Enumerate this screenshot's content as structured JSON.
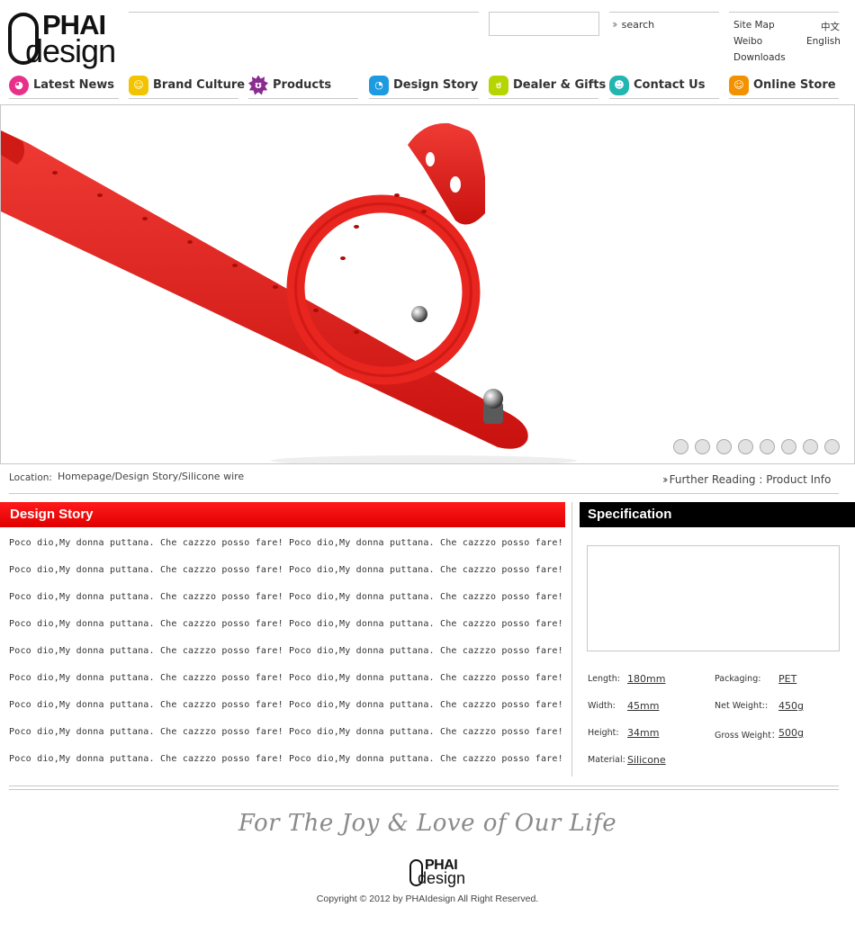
{
  "logo": {
    "top_text": "PHAI",
    "bottom_text": "design"
  },
  "search": {
    "placeholder": "",
    "button_label": "search"
  },
  "utility": {
    "site_map": "Site Map",
    "chinese": "中文",
    "weibo": "Weibo",
    "english": "English",
    "downloads": "Downloads"
  },
  "nav": {
    "items": [
      {
        "label": "Latest News",
        "icon": "smiley-pink-icon",
        "color": "#e8308a"
      },
      {
        "label": "Brand Culture",
        "icon": "smiley-yellow-icon",
        "color": "#f2c400"
      },
      {
        "label": "Products",
        "icon": "smiley-purple-icon",
        "color": "#8a2c8f"
      },
      {
        "label": "Design Story",
        "icon": "smiley-blue-icon",
        "color": "#1e9be0"
      },
      {
        "label": "Dealer & Gifts",
        "icon": "smiley-lime-icon",
        "color": "#b6d400"
      },
      {
        "label": "Contact Us",
        "icon": "smiley-teal-icon",
        "color": "#23b5b0"
      },
      {
        "label": "Online Store",
        "icon": "smiley-orange-icon",
        "color": "#f39200"
      }
    ]
  },
  "hero": {
    "slide_count": 8,
    "image": "red-silicone-bracelet-photo"
  },
  "location": {
    "label": "Location:",
    "path": "Homepage/Design Story/Silicone wire",
    "further_reading": "Further Reading : Product Info"
  },
  "design_story": {
    "title": "Design Story",
    "lines": [
      "Poco dio,My donna puttana. Che cazzzo posso fare! Poco dio,My donna puttana. Che cazzzo posso fare!",
      "Poco dio,My donna puttana. Che cazzzo posso fare! Poco dio,My donna puttana. Che cazzzo posso fare!",
      "Poco dio,My donna puttana. Che cazzzo posso fare! Poco dio,My donna puttana. Che cazzzo posso fare!",
      "Poco dio,My donna puttana. Che cazzzo posso fare! Poco dio,My donna puttana. Che cazzzo posso fare!",
      "Poco dio,My donna puttana. Che cazzzo posso fare! Poco dio,My donna puttana. Che cazzzo posso fare!",
      "Poco dio,My donna puttana. Che cazzzo posso fare! Poco dio,My donna puttana. Che cazzzo posso fare!",
      "Poco dio,My donna puttana. Che cazzzo posso fare! Poco dio,My donna puttana. Che cazzzo posso fare!",
      "Poco dio,My donna puttana. Che cazzzo posso fare! Poco dio,My donna puttana. Che cazzzo posso fare!",
      "Poco dio,My donna puttana. Che cazzzo posso fare! Poco dio,My donna puttana. Che cazzzo posso fare!"
    ]
  },
  "specification": {
    "title": "Specification",
    "length_label": "Length:",
    "length_value": "180mm",
    "width_label": "Width:",
    "width_value": "45mm",
    "height_label": "Height:",
    "height_value": "34mm",
    "material_label": "Material:",
    "material_value": "Silicone",
    "packaging_label": "Packaging:",
    "packaging_value": "PET",
    "net_weight_label": "Net Weight::",
    "net_weight_value": "450g",
    "gross_weight_label": "Gross Weight：",
    "gross_weight_value": "500g"
  },
  "footer": {
    "slogan": "For The Joy & Love of Our Life",
    "copyright": "Copyright © 2012 by PHAIdesign All Right Reserved."
  },
  "colors": {
    "design_story_header": "#ff0000",
    "specification_header": "#000000",
    "product_red": "#e8201e"
  }
}
